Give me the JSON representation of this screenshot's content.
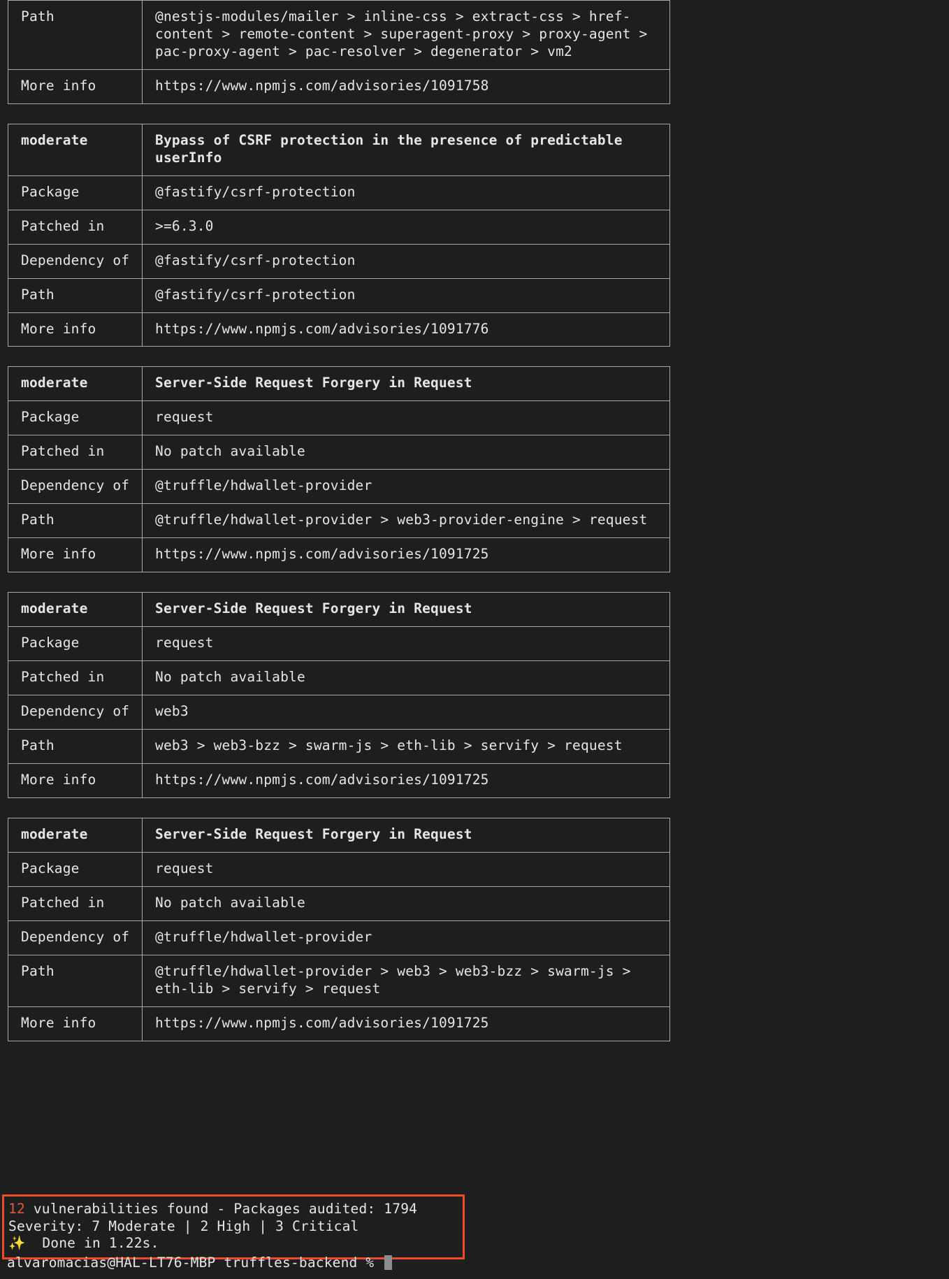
{
  "terminal": {
    "prompt": "alvaromacias@HAL-LT76-MBP truffles-backend % ",
    "cursor": "block-cursor"
  },
  "labels": {
    "path": "Path",
    "more_info": "More info",
    "package": "Package",
    "patched_in": "Patched in",
    "dependency_of": "Dependency of"
  },
  "partial_block": {
    "path_label": "Path",
    "path_value": "@nestjs-modules/mailer > inline-css > extract-css > href-content > remote-content > superagent-proxy > proxy-agent > pac-proxy-agent > pac-resolver > degenerator > vm2",
    "more_info_label": "More info",
    "more_info_value": "https://www.npmjs.com/advisories/1091758"
  },
  "vulnerabilities": [
    {
      "severity": "moderate",
      "title": "Bypass of CSRF protection in the presence of predictable userInfo",
      "package": "@fastify/csrf-protection",
      "patched_in": ">=6.3.0",
      "dependency_of": "@fastify/csrf-protection",
      "path": "@fastify/csrf-protection",
      "more_info": "https://www.npmjs.com/advisories/1091776"
    },
    {
      "severity": "moderate",
      "title": "Server-Side Request Forgery in Request",
      "package": "request",
      "patched_in": "No patch available",
      "dependency_of": "@truffle/hdwallet-provider",
      "path": "@truffle/hdwallet-provider > web3-provider-engine > request",
      "more_info": "https://www.npmjs.com/advisories/1091725"
    },
    {
      "severity": "moderate",
      "title": "Server-Side Request Forgery in Request",
      "package": "request",
      "patched_in": "No patch available",
      "dependency_of": "web3",
      "path": "web3 > web3-bzz > swarm-js > eth-lib > servify > request",
      "more_info": "https://www.npmjs.com/advisories/1091725"
    },
    {
      "severity": "moderate",
      "title": "Server-Side Request Forgery in Request",
      "package": "request",
      "patched_in": "No patch available",
      "dependency_of": "@truffle/hdwallet-provider",
      "path": "@truffle/hdwallet-provider > web3 > web3-bzz > swarm-js > eth-lib > servify > request",
      "more_info": "https://www.npmjs.com/advisories/1091725"
    }
  ],
  "summary": {
    "count": "12",
    "count_text": " vulnerabilities found - Packages audited: 1794",
    "severity_line": "Severity: 7 Moderate | 2 High | 3 Critical",
    "sparkle": "✨",
    "done_text": "  Done in 1.22s."
  },
  "colors": {
    "background": "#1d1f1e",
    "border": "#a8a8a8",
    "text": "#e6e6e6",
    "moderate": "#c8c53f",
    "alert_box": "#f04a28",
    "count_red": "#e8553a",
    "sparkle": "#f0c040",
    "cursor": "#8d8d8d"
  }
}
